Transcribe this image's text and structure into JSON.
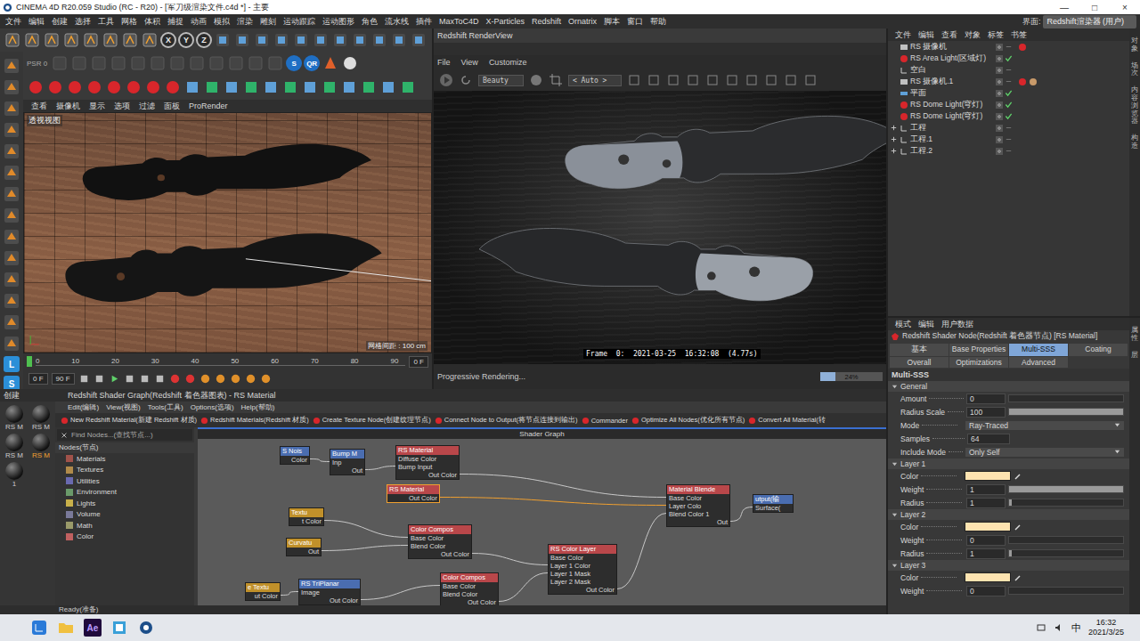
{
  "window": {
    "title": "CINEMA 4D R20.059 Studio (RC - R20) - [军刀级渲染文件.c4d *] - 主要",
    "controls": [
      "—",
      "□",
      "×"
    ]
  },
  "menu": [
    "文件",
    "编辑",
    "创建",
    "选择",
    "工具",
    "网格",
    "体积",
    "捕捉",
    "动画",
    "模拟",
    "渲染",
    "雕刻",
    "运动跟踪",
    "运动图形",
    "角色",
    "流水线",
    "插件",
    "MaxToC4D",
    "X-Particles",
    "Redshift",
    "Ornatrix",
    "脚本",
    "窗口",
    "帮助"
  ],
  "layout_switch": {
    "label": "界面:",
    "value": "Redshift渲染器 (用户)"
  },
  "toolbar": {
    "axes": [
      "X",
      "Y",
      "Z"
    ],
    "psr": "PSR",
    "psr_value": "0",
    "badges": [
      "S",
      "QR"
    ]
  },
  "left_tools": {
    "badges": [
      "L",
      "S"
    ]
  },
  "viewport": {
    "menu": [
      "查看",
      "摄像机",
      "显示",
      "选项",
      "过滤",
      "面板",
      "ProRender"
    ],
    "label": "透视视图",
    "grid": "网格间距 : 100 cm"
  },
  "timeline": {
    "ticks": [
      "0",
      "10",
      "20",
      "30",
      "40",
      "50",
      "60",
      "70",
      "80",
      "90"
    ],
    "end_field": "0 F",
    "fields": [
      "0 F",
      "90 F"
    ]
  },
  "renderview": {
    "title": "Redshift RenderView",
    "menu": [
      "File",
      "View",
      "Customize"
    ],
    "aov": "Beauty",
    "zoom": "< Auto >",
    "stamp": "Frame  0:  2021-03-25  16:32:08  (4.77s)",
    "status": "Progressive Rendering...",
    "progress": {
      "level": 0.24,
      "reading": "24%"
    }
  },
  "objects": {
    "menu": [
      "文件",
      "编辑",
      "查看",
      "对象",
      "标签",
      "书签"
    ],
    "items": [
      {
        "name": "RS 摄像机",
        "kind": "camera",
        "expandable": false,
        "checked": false,
        "tags": 1
      },
      {
        "name": "RS Area Light(区域灯)",
        "kind": "light",
        "expandable": false,
        "checked": true,
        "tags": 0
      },
      {
        "name": "空白",
        "kind": "null",
        "expandable": false,
        "checked": false,
        "tags": 0
      },
      {
        "name": "RS 摄像机.1",
        "kind": "camera",
        "expandable": false,
        "checked": false,
        "tags": 2
      },
      {
        "name": "平面",
        "kind": "plane",
        "expandable": false,
        "checked": true,
        "tags": 0
      },
      {
        "name": "RS Dome Light(穹灯)",
        "kind": "light",
        "expandable": false,
        "checked": true,
        "tags": 0
      },
      {
        "name": "RS Dome Light(穹灯)",
        "kind": "light",
        "expandable": false,
        "checked": true,
        "tags": 0
      },
      {
        "name": "工程",
        "kind": "null",
        "expandable": true,
        "checked": false,
        "tags": 0
      },
      {
        "name": "工程.1",
        "kind": "null",
        "expandable": true,
        "checked": false,
        "tags": 0
      },
      {
        "name": "工程.2",
        "kind": "null",
        "expandable": true,
        "checked": false,
        "tags": 0
      }
    ],
    "side_tabs": [
      "对象",
      "场次",
      "内容浏览器",
      "构造"
    ]
  },
  "attributes": {
    "menu": [
      "模式",
      "编辑",
      "用户数据"
    ],
    "title": "Redshift Shader Node(Redshift 着色器节点) [RS Material]",
    "tabs": [
      {
        "label": "基本",
        "selected": false
      },
      {
        "label": "Base Properties",
        "selected": false
      },
      {
        "label": "Multi-SSS",
        "selected": true
      },
      {
        "label": "Coating",
        "selected": false
      },
      {
        "label": "Overall",
        "selected": false
      },
      {
        "label": "Optimizations",
        "selected": false
      },
      {
        "label": "Advanced",
        "selected": false
      }
    ],
    "section": "Multi-SSS",
    "groups": [
      {
        "title": "General",
        "rows": [
          {
            "label": "Amount",
            "kind": "slider",
            "value": "0",
            "level": 0
          },
          {
            "label": "Radius Scale",
            "kind": "slider",
            "value": "100",
            "level": 1
          },
          {
            "label": "Mode",
            "kind": "select",
            "value": "Ray-Traced"
          },
          {
            "label": "Samples",
            "kind": "number",
            "value": "64"
          },
          {
            "label": "Include Mode",
            "kind": "select",
            "value": "Only Self"
          }
        ]
      },
      {
        "title": "Layer 1",
        "rows": [
          {
            "label": "Color",
            "kind": "color",
            "color": "#fde3b0"
          },
          {
            "label": "Weight",
            "kind": "slider",
            "value": "1",
            "level": 1
          },
          {
            "label": "Radius",
            "kind": "slider",
            "value": "1",
            "level": 0.02
          }
        ]
      },
      {
        "title": "Layer 2",
        "rows": [
          {
            "label": "Color",
            "kind": "color",
            "color": "#fde3b0"
          },
          {
            "label": "Weight",
            "kind": "slider",
            "value": "0",
            "level": 0
          },
          {
            "label": "Radius",
            "kind": "slider",
            "value": "1",
            "level": 0.02
          }
        ]
      },
      {
        "title": "Layer 3",
        "rows": [
          {
            "label": "Color",
            "kind": "color",
            "color": "#fde3b0"
          },
          {
            "label": "Weight",
            "kind": "slider",
            "value": "0",
            "level": 0
          }
        ]
      }
    ],
    "side_tabs": [
      "属性",
      "层"
    ]
  },
  "materials": {
    "menu": [
      "创建"
    ],
    "items": [
      {
        "label": "RS M",
        "selected": false
      },
      {
        "label": "RS M",
        "selected": false
      },
      {
        "label": "RS M",
        "selected": false
      },
      {
        "label": "RS M",
        "selected": true
      },
      {
        "label": "1",
        "selected": false
      }
    ]
  },
  "shader_graph": {
    "title": "Redshift Shader Graph(Redshift 着色器图表) - RS Material",
    "menu": [
      "Edit(编辑)",
      "View(视图)",
      "Tools(工具)",
      "Options(选项)",
      "Help(帮助)"
    ],
    "actions": [
      "New Redshift Material(新建 Redshift 材质)",
      "Redshift Materials(Redshift 材质)",
      "Create Texture Node(创建纹理节点)",
      "Connect Node to Output(将节点连接到输出)",
      "Commander",
      "Optimize All Nodes(优化所有节点)",
      "Convert All Material(转"
    ],
    "search": {
      "placeholder": "Find Nodes...(查找节点...)"
    },
    "tree_title": "Nodes(节点)",
    "categories": [
      {
        "label": "Materials",
        "color": "#a0524a"
      },
      {
        "label": "Textures",
        "color": "#b08a4a"
      },
      {
        "label": "Utilities",
        "color": "#6a6ab0"
      },
      {
        "label": "Environment",
        "color": "#6a9a6a"
      },
      {
        "label": "Lights",
        "color": "#c8b04a"
      },
      {
        "label": "Volume",
        "color": "#7a7a9a"
      },
      {
        "label": "Math",
        "color": "#9a9a6a"
      },
      {
        "label": "Color",
        "color": "#c06060"
      }
    ],
    "canvas_title": "Shader Graph",
    "nodes": [
      {
        "title": "S Nois",
        "color": "#4a6db0",
        "selected": false,
        "ports": [
          {
            "label": "Color",
            "out": true
          }
        ]
      },
      {
        "title": "Bump M",
        "color": "#4a6db0",
        "selected": false,
        "ports": [
          {
            "label": "Inp",
            "out": false
          },
          {
            "label": "Out",
            "out": true
          }
        ]
      },
      {
        "title": "RS Material",
        "color": "#b9474a",
        "selected": false,
        "ports": [
          {
            "label": "Diffuse Color",
            "out": false
          },
          {
            "label": "Bump Input",
            "out": false
          },
          {
            "label": "Out Color",
            "out": true
          }
        ]
      },
      {
        "title": "RS Material",
        "color": "#b9474a",
        "selected": true,
        "ports": [
          {
            "label": "Out Color",
            "out": true
          }
        ]
      },
      {
        "title": "Material Blende",
        "color": "#b9474a",
        "selected": false,
        "ports": [
          {
            "label": "Base Color",
            "out": false
          },
          {
            "label": "Layer Colo",
            "out": false
          },
          {
            "label": "Blend Color 1",
            "out": false
          },
          {
            "label": "Out",
            "out": true
          }
        ]
      },
      {
        "title": "utput(输",
        "color": "#4a6db0",
        "selected": false,
        "ports": [
          {
            "label": "Surface(",
            "out": false
          }
        ]
      },
      {
        "title": "Textu",
        "color": "#c0902a",
        "selected": false,
        "ports": [
          {
            "label": "t Color",
            "out": true
          }
        ]
      },
      {
        "title": "Curvatu",
        "color": "#c0902a",
        "selected": false,
        "ports": [
          {
            "label": "Out",
            "out": true
          }
        ]
      },
      {
        "title": "Color Compos",
        "color": "#b9474a",
        "selected": false,
        "ports": [
          {
            "label": "Base Color",
            "out": false
          },
          {
            "label": "Blend Color",
            "out": false
          },
          {
            "label": "Out Color",
            "out": true
          }
        ]
      },
      {
        "title": "RS Color Layer",
        "color": "#b9474a",
        "selected": false,
        "ports": [
          {
            "label": "Base Color",
            "out": false
          },
          {
            "label": "Layer 1 Color",
            "out": false
          },
          {
            "label": "Layer 1 Mask",
            "out": false
          },
          {
            "label": "Layer 2 Mask",
            "out": false
          },
          {
            "label": "Out Color",
            "out": true
          }
        ]
      },
      {
        "title": "RS TriPlanar",
        "color": "#4a6db0",
        "selected": false,
        "ports": [
          {
            "label": "Image",
            "out": false
          },
          {
            "label": "Out Color",
            "out": true
          }
        ]
      },
      {
        "title": "Color Compos",
        "color": "#b9474a",
        "selected": false,
        "ports": [
          {
            "label": "Base Color",
            "out": false
          },
          {
            "label": "Blend Color",
            "out": false
          },
          {
            "label": "Out Color",
            "out": true
          }
        ]
      },
      {
        "title": "e Textu",
        "color": "#c0902a",
        "selected": false,
        "ports": [
          {
            "label": "ut Color",
            "out": true
          }
        ]
      }
    ],
    "edges": [
      {
        "from": 12,
        "to": 10,
        "port": 0,
        "selected": false
      },
      {
        "from": 0,
        "to": 1,
        "port": 0,
        "selected": false
      },
      {
        "from": 1,
        "to": 2,
        "port": 1,
        "selected": false
      },
      {
        "from": 2,
        "to": 4,
        "port": 0,
        "selected": false
      },
      {
        "from": 3,
        "to": 4,
        "port": 1,
        "selected": true
      },
      {
        "from": 6,
        "to": 8,
        "port": 0,
        "selected": false
      },
      {
        "from": 7,
        "to": 8,
        "port": 1,
        "selected": false
      },
      {
        "from": 10,
        "to": 11,
        "port": 0,
        "selected": false
      },
      {
        "from": 8,
        "to": 9,
        "port": 1,
        "selected": false
      },
      {
        "from": 11,
        "to": 9,
        "port": 2,
        "selected": false
      },
      {
        "from": 9,
        "to": 4,
        "port": 2,
        "selected": false
      },
      {
        "from": 4,
        "to": 5,
        "port": 0,
        "selected": false
      }
    ]
  },
  "status": "Ready(准备)",
  "taskbar": {
    "app_label": "Ae",
    "ime": "中",
    "time": "16:32",
    "date": "2021/3/25"
  }
}
